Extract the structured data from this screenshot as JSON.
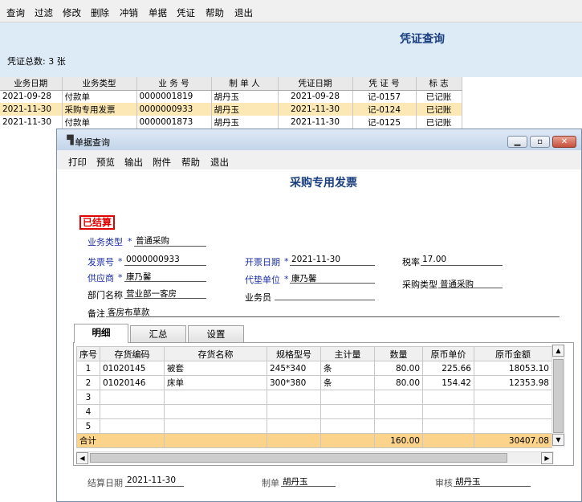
{
  "bg": {
    "menu": [
      "查询",
      "过滤",
      "修改",
      "删除",
      "冲销",
      "单据",
      "凭证",
      "帮助",
      "退出"
    ],
    "title": "凭证查询",
    "count_label": "凭证总数: 3 张",
    "table": {
      "headers": [
        "业务日期",
        "业务类型",
        "业 务 号",
        "制 单 人",
        "凭证日期",
        "凭 证 号",
        "标    志"
      ],
      "rows": [
        [
          "2021-09-28",
          "付款单",
          "0000001819",
          "胡丹玉",
          "2021-09-28",
          "记-0157",
          "已记账"
        ],
        [
          "2021-11-30",
          "采购专用发票",
          "0000000933",
          "胡丹玉",
          "2021-11-30",
          "记-0124",
          "已记账"
        ],
        [
          "2021-11-30",
          "付款单",
          "0000001873",
          "胡丹玉",
          "2021-11-30",
          "记-0125",
          "已记账"
        ]
      ]
    }
  },
  "win": {
    "title": "单据查询",
    "menu": [
      "打印",
      "预览",
      "输出",
      "附件",
      "帮助",
      "退出"
    ],
    "doc_title": "采购专用发票",
    "settled": "已结算",
    "fields": {
      "biz_type": {
        "label": "业务类型",
        "value": "普通采购"
      },
      "invoice_no": {
        "label": "发票号",
        "value": "0000000933"
      },
      "invoice_date": {
        "label": "开票日期",
        "value": "2021-11-30"
      },
      "tax_rate": {
        "label": "税率",
        "value": "17.00"
      },
      "supplier": {
        "label": "供应商",
        "value": "康乃馨"
      },
      "agent": {
        "label": "代垫单位",
        "value": "康乃馨"
      },
      "purchase_type": {
        "label": "采购类型",
        "value": "普通采购"
      },
      "department": {
        "label": "部门名称",
        "value": "营业部一客房"
      },
      "salesman": {
        "label": "业务员",
        "value": ""
      },
      "remark": {
        "label": "备注",
        "value": "客房布草款"
      }
    },
    "tabs": [
      "明细",
      "汇总",
      "设置"
    ],
    "grid": {
      "headers": [
        "序号",
        "存货编码",
        "存货名称",
        "规格型号",
        "主计量",
        "数量",
        "原币单价",
        "原币金额"
      ],
      "rows": [
        [
          "1",
          "01020145",
          "被套",
          "245*340",
          "条",
          "80.00",
          "225.66",
          "18053.10"
        ],
        [
          "2",
          "01020146",
          "床单",
          "300*380",
          "条",
          "80.00",
          "154.42",
          "12353.98"
        ],
        [
          "3",
          "",
          "",
          "",
          "",
          "",
          "",
          ""
        ],
        [
          "4",
          "",
          "",
          "",
          "",
          "",
          "",
          ""
        ],
        [
          "5",
          "",
          "",
          "",
          "",
          "",
          "",
          ""
        ]
      ],
      "sum_label": "合计",
      "sum_qty": "160.00",
      "sum_amount": "30407.08"
    },
    "footer": {
      "settle_date": {
        "label": "结算日期",
        "value": "2021-11-30"
      },
      "maker": {
        "label": "制单",
        "value": "胡丹玉"
      },
      "auditor": {
        "label": "审核",
        "value": "胡丹玉"
      }
    }
  }
}
